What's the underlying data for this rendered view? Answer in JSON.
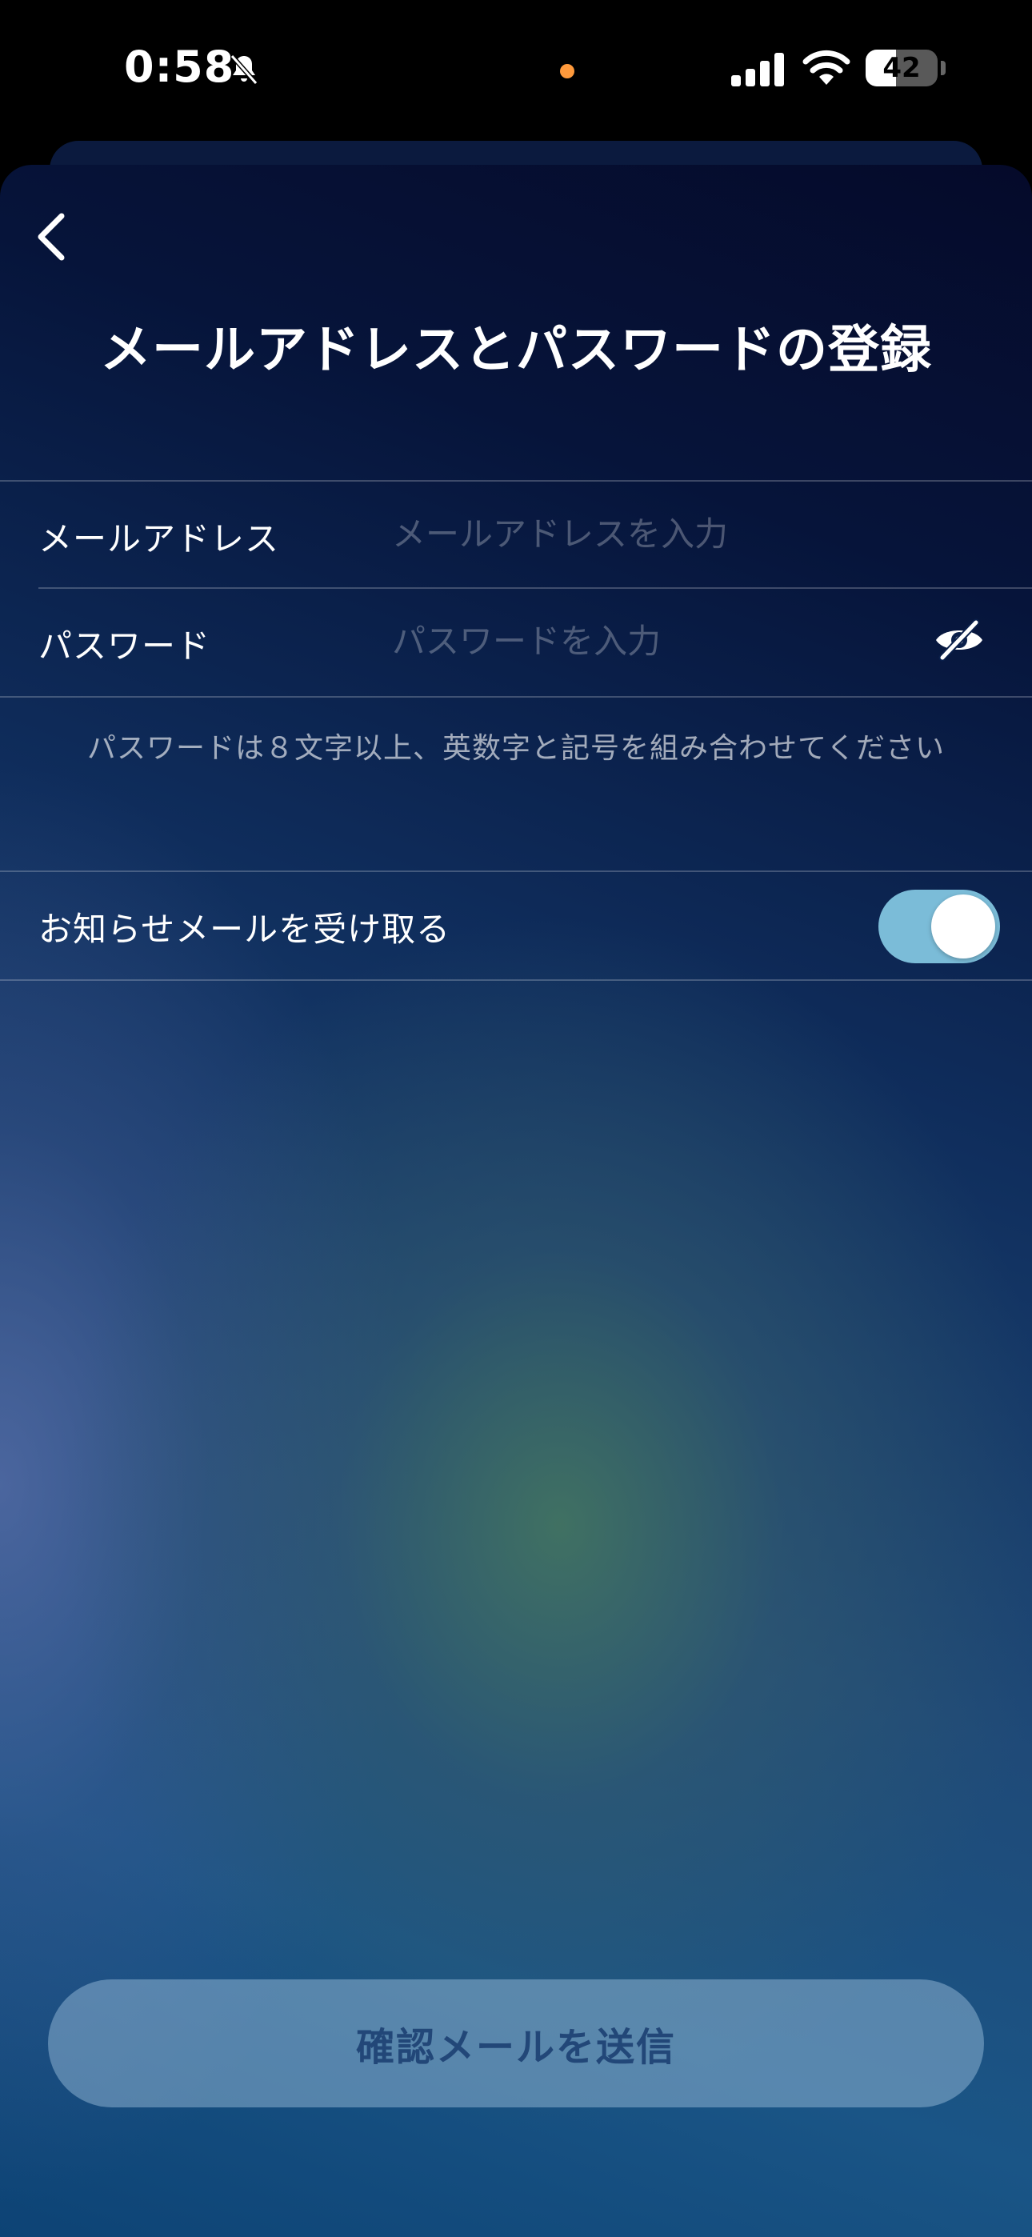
{
  "status_bar": {
    "time": "0:58",
    "battery_level": 42,
    "battery_text": "42",
    "icons": [
      "bell-slash-icon",
      "signal-icon",
      "wifi-icon",
      "battery-icon"
    ],
    "mic_indicator_color": "#ff9a3c"
  },
  "header": {
    "back_icon": "chevron-left-icon",
    "title": "メールアドレスとパスワードの登録"
  },
  "form": {
    "email": {
      "label": "メールアドレス",
      "value": "",
      "placeholder": "メールアドレスを入力"
    },
    "password": {
      "label": "パスワード",
      "value": "",
      "placeholder": "パスワードを入力",
      "toggle_icon": "eye-slash-icon"
    },
    "password_hint": "パスワードは８文字以上、英数字と記号を組み合わせてください"
  },
  "newsletter": {
    "label": "お知らせメールを受け取る",
    "enabled": true,
    "toggle_color": "#7bbcd8"
  },
  "submit": {
    "label": "確認メールを送信",
    "enabled": false
  }
}
